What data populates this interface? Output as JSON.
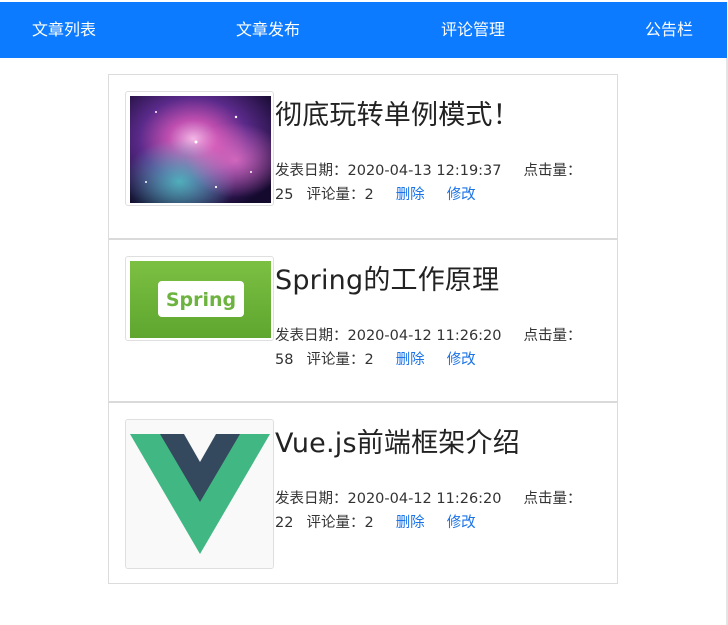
{
  "nav": {
    "items": [
      "文章列表",
      "文章发布",
      "评论管理",
      "公告栏"
    ]
  },
  "labels": {
    "date_prefix": "发表日期：",
    "clicks_prefix": "点击量：",
    "comments_prefix": "评论量：",
    "delete": "删除",
    "edit": "修改"
  },
  "articles": [
    {
      "title": "彻底玩转单例模式！",
      "date": "2020-04-13 12:19:37",
      "clicks": "25",
      "comments": "2",
      "thumbnail": "galaxy-image"
    },
    {
      "title": "Spring的工作原理",
      "date": "2020-04-12 11:26:20",
      "clicks": "58",
      "comments": "2",
      "thumbnail": "spring-logo",
      "thumbnail_text": "Spring"
    },
    {
      "title": "Vue.js前端框架介绍",
      "date": "2020-04-12 11:26:20",
      "clicks": "22",
      "comments": "2",
      "thumbnail": "vue-logo"
    }
  ],
  "colors": {
    "nav_bg": "#0d7bff",
    "link": "#1a73e8",
    "spring_green": "#6db33f",
    "vue_green": "#41b883",
    "vue_dark": "#35495e"
  }
}
